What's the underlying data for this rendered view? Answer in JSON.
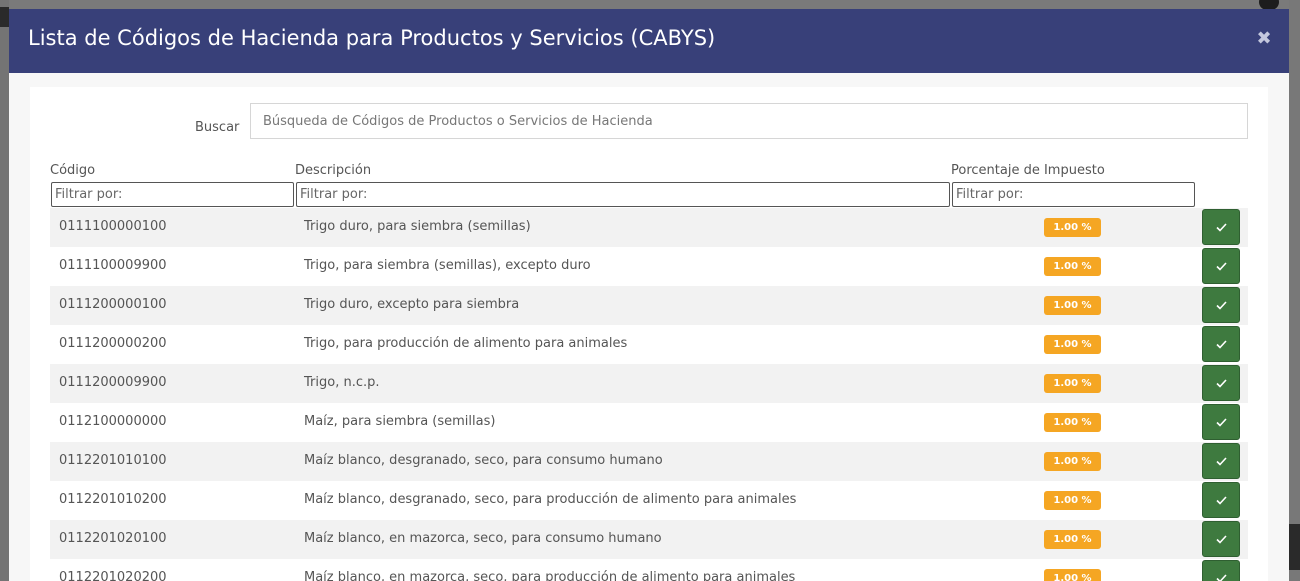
{
  "modal": {
    "title": "Lista de Códigos de Hacienda para Productos y Servicios (CABYS)",
    "close_icon": "close-icon"
  },
  "search": {
    "label": "Buscar",
    "placeholder": "Búsqueda de Códigos de Productos o Servicios de Hacienda",
    "value": ""
  },
  "table": {
    "columns": [
      {
        "label": "Código",
        "filter_placeholder": "Filtrar por:"
      },
      {
        "label": "Descripción",
        "filter_placeholder": "Filtrar por:"
      },
      {
        "label": "Porcentaje de Impuesto",
        "filter_placeholder": "Filtrar por:"
      }
    ],
    "rows": [
      {
        "code": "0111100000100",
        "description": "Trigo duro, para siembra (semillas)",
        "tax": "1.00 %"
      },
      {
        "code": "0111100009900",
        "description": "Trigo, para siembra (semillas), excepto duro",
        "tax": "1.00 %"
      },
      {
        "code": "0111200000100",
        "description": "Trigo duro, excepto para siembra",
        "tax": "1.00 %"
      },
      {
        "code": "0111200000200",
        "description": "Trigo, para producción de alimento para animales",
        "tax": "1.00 %"
      },
      {
        "code": "0111200009900",
        "description": "Trigo, n.c.p.",
        "tax": "1.00 %"
      },
      {
        "code": "0112100000000",
        "description": "Maíz, para siembra (semillas)",
        "tax": "1.00 %"
      },
      {
        "code": "0112201010100",
        "description": "Maíz blanco, desgranado, seco, para consumo humano",
        "tax": "1.00 %"
      },
      {
        "code": "0112201010200",
        "description": "Maíz blanco, desgranado, seco, para producción de alimento para animales",
        "tax": "1.00 %"
      },
      {
        "code": "0112201020100",
        "description": "Maíz blanco, en mazorca, seco, para consumo humano",
        "tax": "1.00 %"
      },
      {
        "code": "0112201020200",
        "description": "Maíz blanco, en mazorca, seco, para producción de alimento para animales",
        "tax": "1.00 %"
      }
    ],
    "select_icon": "check-icon"
  },
  "colors": {
    "header_bg": "#384079",
    "badge": "#f5a623",
    "select_button": "#3e7a3f"
  }
}
